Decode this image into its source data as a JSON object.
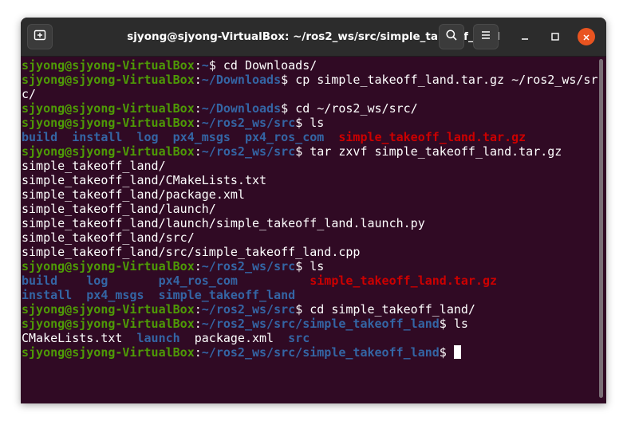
{
  "window": {
    "title": "sjyong@sjyong-VirtualBox: ~/ros2_ws/src/simple_takeoff_land",
    "icons": {
      "new_tab": "new-tab-icon",
      "search": "search-icon",
      "menu": "hamburger-menu-icon",
      "minimize": "minimize-icon",
      "maximize": "maximize-icon",
      "close": "close-icon"
    },
    "accent_color": "#e95420"
  },
  "colors": {
    "background": "#300a24",
    "user_host": "#4e9a06",
    "path": "#3465a4",
    "directory": "#3465a4",
    "archive": "#cc0000",
    "text": "#ffffff"
  },
  "terminal": {
    "user_host": "sjyong@sjyong-VirtualBox",
    "lines": [
      {
        "prompt_path": "~",
        "command": "cd Downloads/"
      },
      {
        "prompt_path": "~/Downloads",
        "command": "cp simple_takeoff_land.tar.gz ~/ros2_ws/sr"
      },
      {
        "text": "c/"
      },
      {
        "prompt_path": "~/Downloads",
        "command": "cd ~/ros2_ws/src/"
      },
      {
        "prompt_path": "~/ros2_ws/src",
        "command": "ls"
      },
      {
        "ls1": [
          "build",
          "install",
          "log",
          "px4_msgs",
          "px4_ros_com",
          "simple_takeoff_land.tar.gz"
        ]
      },
      {
        "prompt_path": "~/ros2_ws/src",
        "command": "tar zxvf simple_takeoff_land.tar.gz"
      },
      {
        "text": "simple_takeoff_land/"
      },
      {
        "text": "simple_takeoff_land/CMakeLists.txt"
      },
      {
        "text": "simple_takeoff_land/package.xml"
      },
      {
        "text": "simple_takeoff_land/launch/"
      },
      {
        "text": "simple_takeoff_land/launch/simple_takeoff_land.launch.py"
      },
      {
        "text": "simple_takeoff_land/src/"
      },
      {
        "text": "simple_takeoff_land/src/simple_takeoff_land.cpp"
      },
      {
        "prompt_path": "~/ros2_ws/src",
        "command": "ls"
      },
      {
        "ls2a": [
          "build",
          "log",
          "px4_ros_com",
          "simple_takeoff_land.tar.gz"
        ]
      },
      {
        "ls2b": [
          "install",
          "px4_msgs",
          "simple_takeoff_land"
        ]
      },
      {
        "prompt_path": "~/ros2_ws/src",
        "command": "cd simple_takeoff_land/"
      },
      {
        "prompt_path": "~/ros2_ws/src/simple_takeoff_land",
        "command": "ls"
      },
      {
        "ls3": [
          "CMakeLists.txt",
          "launch",
          "package.xml",
          "src"
        ]
      },
      {
        "prompt_path": "~/ros2_ws/src/simple_takeoff_land",
        "command": ""
      }
    ]
  }
}
